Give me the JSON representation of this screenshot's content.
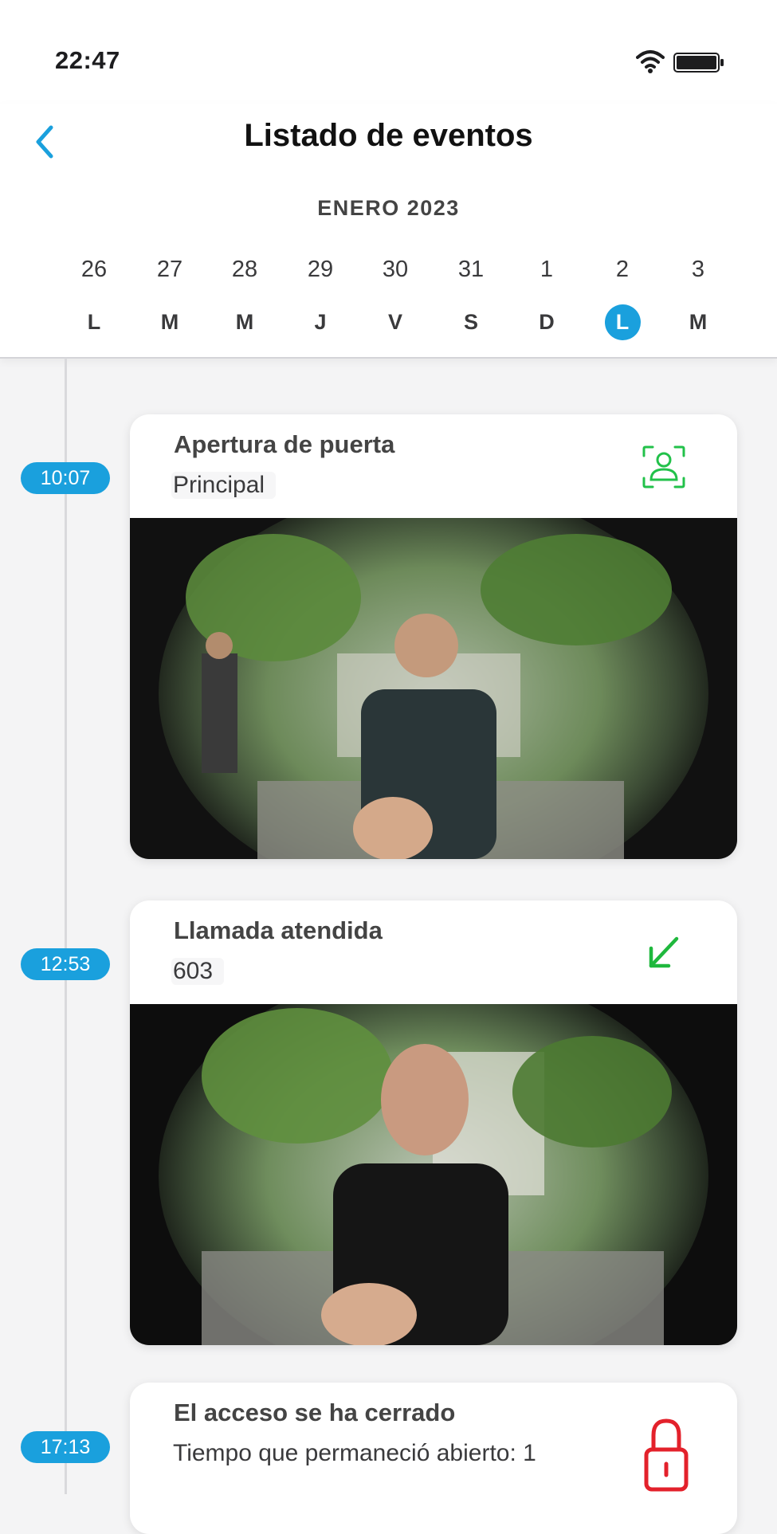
{
  "status_bar": {
    "time": "22:47"
  },
  "header": {
    "title": "Listado de eventos",
    "month": "ENERO 2023",
    "days": [
      {
        "num": "26",
        "letter": "L",
        "selected": false
      },
      {
        "num": "27",
        "letter": "M",
        "selected": false
      },
      {
        "num": "28",
        "letter": "M",
        "selected": false
      },
      {
        "num": "29",
        "letter": "J",
        "selected": false
      },
      {
        "num": "30",
        "letter": "V",
        "selected": false
      },
      {
        "num": "31",
        "letter": "S",
        "selected": false
      },
      {
        "num": "1",
        "letter": "D",
        "selected": false
      },
      {
        "num": "2",
        "letter": "L",
        "selected": true
      },
      {
        "num": "3",
        "letter": "M",
        "selected": false
      }
    ]
  },
  "events": [
    {
      "time": "10:07",
      "title": "Apertura de puerta",
      "subtitle": "Principal",
      "icon": "face-recognition-icon",
      "icon_color": "#22c14a"
    },
    {
      "time": "12:53",
      "title": "Llamada atendida",
      "subtitle": "603",
      "icon": "incoming-call-arrow-icon",
      "icon_color": "#1fb83d"
    },
    {
      "time": "17:13",
      "title": "El acceso  se ha cerrado",
      "subtitle": "Tiempo que permaneció abierto: 1",
      "icon": "lock-icon",
      "icon_color": "#e3212b"
    }
  ],
  "colors": {
    "accent": "#1aa0dd",
    "success": "#22c14a",
    "danger": "#e3212b"
  }
}
